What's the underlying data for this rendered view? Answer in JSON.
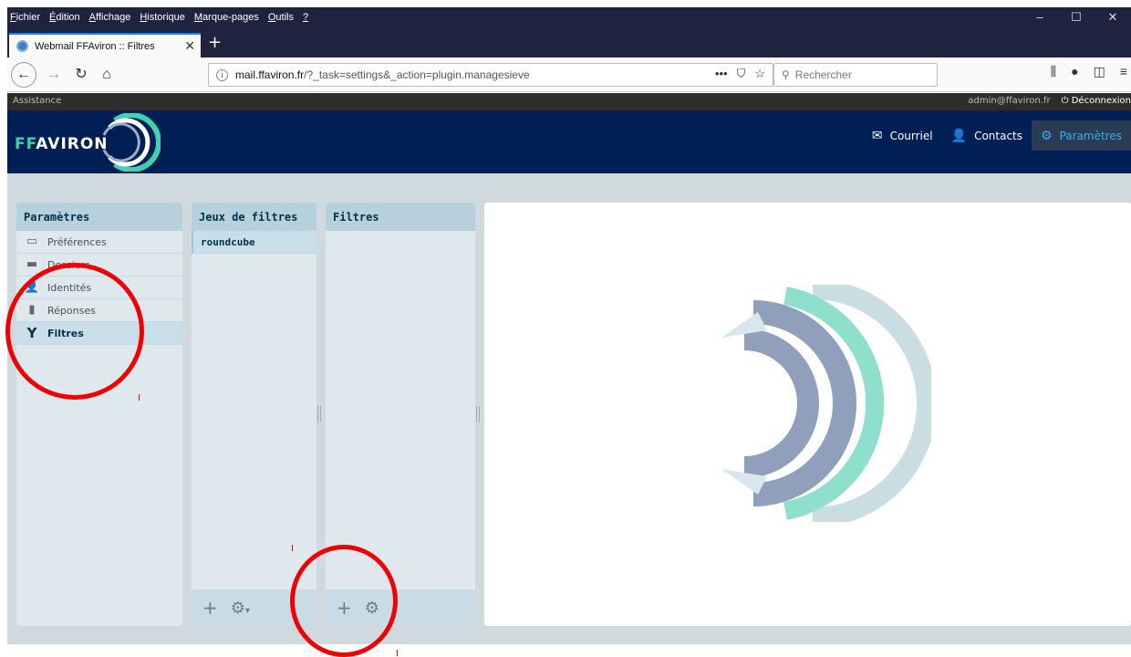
{
  "browser": {
    "menu": [
      {
        "u": "F",
        "rest": "ichier"
      },
      {
        "u": "É",
        "rest": "dition"
      },
      {
        "u": "A",
        "rest": "ffichage"
      },
      {
        "u": "H",
        "rest": "istorique"
      },
      {
        "u": "M",
        "rest": "arque-pages"
      },
      {
        "u": "O",
        "rest": "utils"
      },
      {
        "u": "?",
        "rest": ""
      }
    ],
    "tab_title": "Webmail FFAviron :: Filtres",
    "url_domain": "mail.ffaviron.fr",
    "url_path": "/?_task=settings&_action=plugin.managesieve",
    "search_placeholder": "Rechercher"
  },
  "topline": {
    "assistance": "Assistance",
    "user": "admin@ffaviron.fr",
    "logout": "Déconnexion"
  },
  "logo": {
    "ff": "FF",
    "rest": "AVIRON"
  },
  "nav": {
    "mail": "Courriel",
    "contacts": "Contacts",
    "settings": "Paramètres"
  },
  "prefs": {
    "title": "Paramètres",
    "items": [
      "Préférences",
      "Dossiers",
      "Identités",
      "Réponses",
      "Filtres"
    ]
  },
  "filtersets": {
    "title": "Jeux de filtres",
    "items": [
      "roundcube"
    ]
  },
  "filters": {
    "title": "Filtres"
  },
  "colors": {
    "header": "#001f54",
    "accent": "#37b0e8",
    "annotation": "#e00000"
  }
}
